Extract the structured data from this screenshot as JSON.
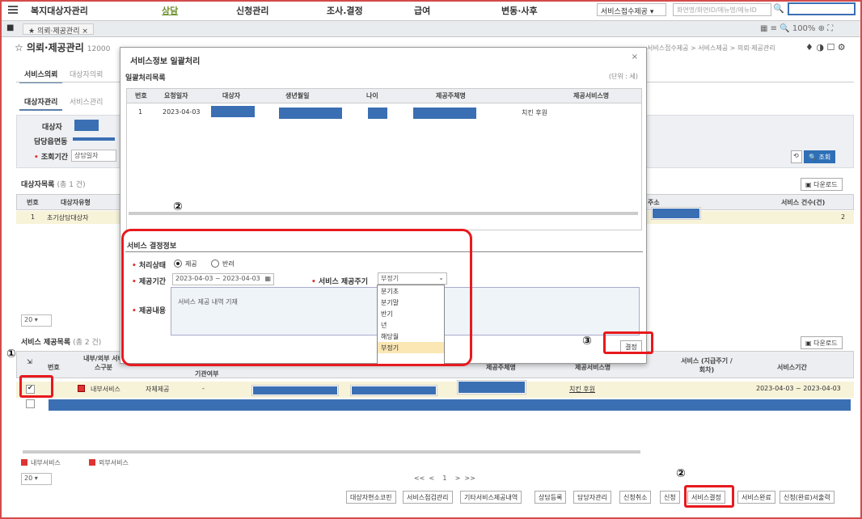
{
  "topnav": {
    "menus": [
      "복지대상자관리",
      "상담",
      "신청관리",
      "조사.결정",
      "급여",
      "변동·사후"
    ],
    "service_select": "서비스접수제공",
    "search_placeholder": "화면명/화면ID/메뉴명/메뉴ID"
  },
  "tabs": {
    "home": "홈",
    "open_tab": "의뢰·제공관리",
    "zoom": "100%"
  },
  "page": {
    "title": "의뢰·제공관리",
    "code": "12000",
    "breadcrumb": "서비스접수제공 > 서비스제공 > 의뢰·제공관리",
    "subtabs": [
      "서비스의뢰",
      "대상자의뢰"
    ],
    "subtabs2": [
      "대상자관리",
      "서비스관리"
    ]
  },
  "filter": {
    "target_label": "대상자",
    "manager_label": "담당읍면동",
    "period_label": "조회기간",
    "period_value": "상담일자",
    "search_button": "조회",
    "refresh_icon": "refresh-icon"
  },
  "target_list": {
    "title": "대상자목록",
    "count": "(총 1 건)",
    "download": "다운로드",
    "headers": [
      "번호",
      "대상자유형",
      "주소",
      "서비스 건수(건)"
    ],
    "rows": [
      {
        "no": "1",
        "type": "초기상담대상자",
        "count": "2"
      }
    ],
    "page_size": "20"
  },
  "service_list": {
    "title": "서비스 제공목록",
    "count": "(총 2 건)",
    "download": "다운로드",
    "headers": [
      "번호",
      "내부/외부 서비스구분",
      "기관여부",
      "제공주체명",
      "제공서비스명",
      "서비스 (지급주기 / 회차)",
      "서비스기간"
    ],
    "rows": [
      {
        "division": "내부서비스",
        "org": "자체제공",
        "dash": "-",
        "service": "치킨 후원",
        "period": "2023-04-03 ~ 2023-04-03"
      }
    ],
    "legend_internal": "내부서비스",
    "legend_external": "외부서비스",
    "page_size": "20",
    "pager": "<<  <    1    >  >>"
  },
  "bottom_buttons": [
    "대상자현소코핀",
    "서비스점검관리",
    "기타서비스제공내역",
    "상담등록",
    "담당자관리",
    "신청취소",
    "신청",
    "서비스결정",
    "서비스완료",
    "신청(완료)서출력"
  ],
  "modal": {
    "title": "서비스정보 일괄처리",
    "close": "×",
    "list_title": "일괄처리목록",
    "unit": "(단위 : 세)",
    "headers": [
      "번호",
      "요청일자",
      "대상자",
      "생년월일",
      "나이",
      "제공주체명",
      "제공서비스명"
    ],
    "rows": [
      {
        "no": "1",
        "date": "2023-04-03",
        "service": "치킨 후원"
      }
    ],
    "decision_title": "서비스 결정정보",
    "status_label": "처리상태",
    "status_options": [
      "제공",
      "반려"
    ],
    "period_label": "제공기간",
    "period_value": "2023-04-03 ~ 2023-04-03",
    "cycle_label": "서비스 제공주기",
    "cycle_value": "부정기",
    "cycle_options": [
      "분기초",
      "분기말",
      "반기",
      "년",
      "해당월",
      "부정기"
    ],
    "content_label": "제공내용",
    "content_value": "서비스 제공 내역 기재",
    "decide_button": "결정"
  },
  "annotations": {
    "n1": "①",
    "n2a": "②",
    "n2b": "②",
    "n3": "③"
  },
  "colors": {
    "annotation": "#e8191e",
    "redaction": "#3b6fb3",
    "accent": "#2e6fb6"
  }
}
